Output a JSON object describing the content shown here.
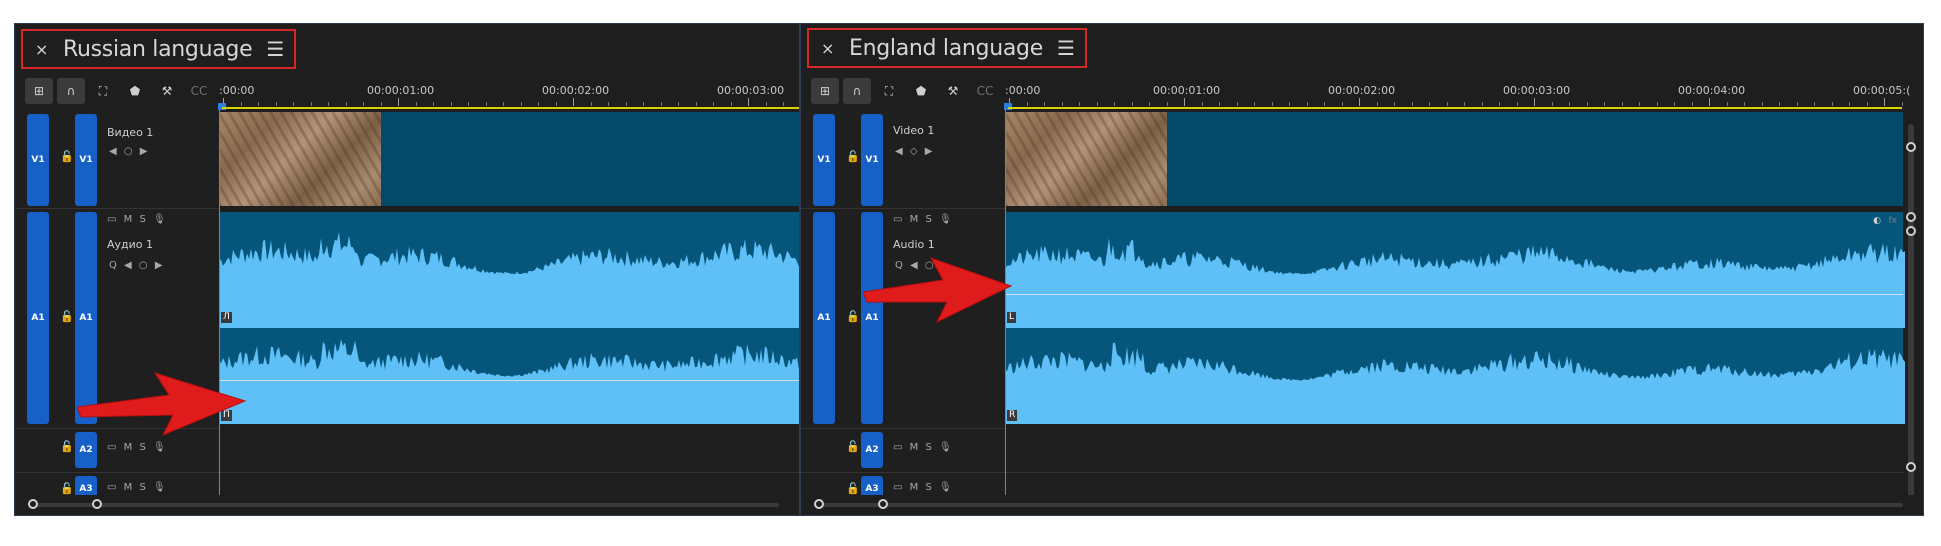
{
  "left_panel": {
    "tab_title": "Russian language",
    "timecodes": [
      ":00:00",
      "00:00:01:00",
      "00:00:02:00",
      "00:00:03:00"
    ],
    "video_track": {
      "target": "V1",
      "source": "V1",
      "name": "Видео 1"
    },
    "audio_track": {
      "target": "A1",
      "source": "A1",
      "name": "Аудио 1",
      "ch_top": "Л",
      "ch_bottom": "П"
    },
    "a2": {
      "label": "A2"
    },
    "a3": {
      "label": "A3"
    },
    "ctrl_m": "M",
    "ctrl_s": "S"
  },
  "right_panel": {
    "tab_title": "England language",
    "timecodes": [
      ":00:00",
      "00:00:01:00",
      "00:00:02:00",
      "00:00:03:00",
      "00:00:04:00",
      "00:00:05:("
    ],
    "video_track": {
      "target": "V1",
      "source": "V1",
      "name": "Video 1"
    },
    "audio_track": {
      "target": "A1",
      "source": "A1",
      "name": "Audio 1",
      "ch_top": "L",
      "ch_bottom": "R"
    },
    "a2": {
      "label": "A2"
    },
    "a3": {
      "label": "A3"
    },
    "ctrl_m": "M",
    "ctrl_s": "S",
    "fx_badge": "fx"
  },
  "icons": {
    "close": "×",
    "menu": "☰",
    "lock": "🔓",
    "mic": "🎙",
    "keyframe_prev": "◀",
    "keyframe_add": "◇",
    "keyframe_next": "▶"
  },
  "colors": {
    "highlight_box": "#d62626",
    "track_target": "#1660c8",
    "video_clip": "#034a69",
    "audio_clip": "#06557a",
    "waveform": "#5ec0f7",
    "arrow": "#e01b1b",
    "work_area": "#d8d200"
  }
}
